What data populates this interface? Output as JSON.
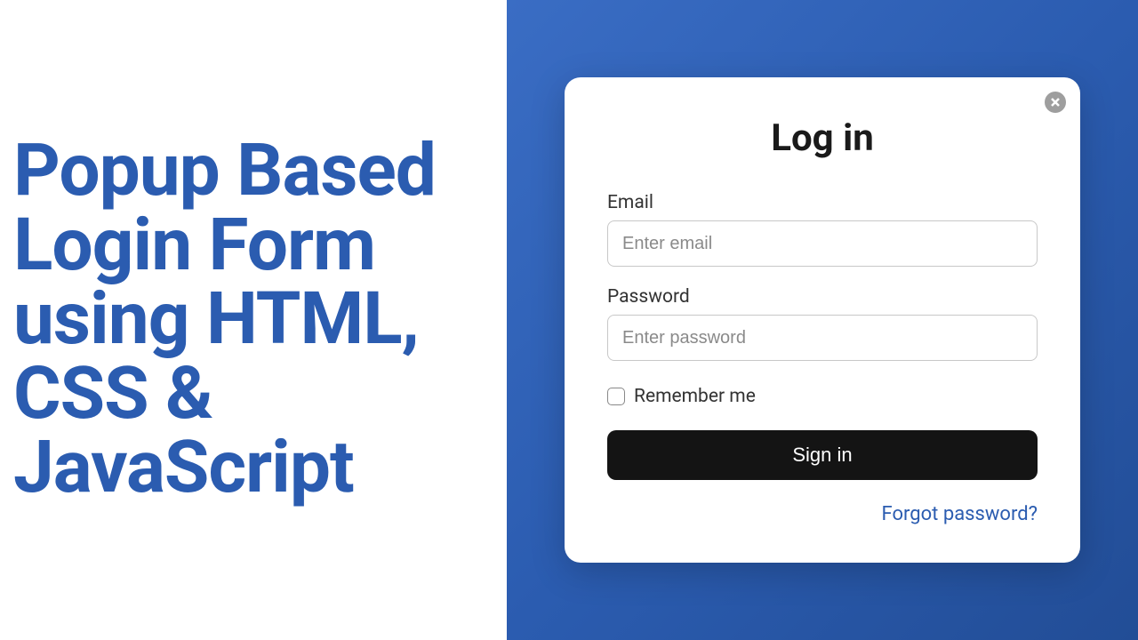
{
  "headline": "Popup Based Login Form using HTML, CSS & JavaScript",
  "card": {
    "title": "Log in",
    "email": {
      "label": "Email",
      "placeholder": "Enter email",
      "value": ""
    },
    "password": {
      "label": "Password",
      "placeholder": "Enter password",
      "value": ""
    },
    "remember": {
      "label": "Remember me",
      "checked": false
    },
    "signin_label": "Sign in",
    "forgot_label": "Forgot password?"
  },
  "colors": {
    "accent": "#2b5cb0",
    "button": "#141414",
    "card_bg": "#ffffff"
  }
}
